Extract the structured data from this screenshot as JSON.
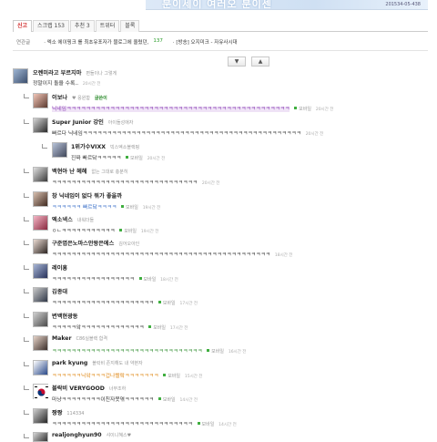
{
  "banner": {
    "text": "분이세이 여러오 분이센",
    "code": "201534-05-438"
  },
  "tabs": [
    {
      "label": "신고",
      "active": true
    },
    {
      "label": "스크랩 153",
      "active": false
    },
    {
      "label": "추천 3",
      "active": false
    },
    {
      "label": "트위터",
      "active": false
    },
    {
      "label": "블록",
      "active": false
    }
  ],
  "related": {
    "label": "연관글",
    "items": [
      {
        "text": "· 엑소 에이핑크 를 최초유포자가 블로그에 올렸던,",
        "count": "137"
      },
      {
        "text": "· [방송] 오지미크 - 자유사시대",
        "count": ""
      }
    ]
  },
  "pager": {
    "up": "▲",
    "down": "▼"
  },
  "comments": [
    {
      "nick": "오렌미라고 부르지마",
      "sub": "편들이나 그렇게",
      "text": "정말이지 돌을 수록..",
      "mobile": "",
      "time": "20시간 전"
    },
    {
      "nick": "이보나",
      "sub": "♥ 응원함",
      "text": "닉네임ㅋㅋㅋㅋㅋㅋㅋㅋㅋㅋㅋㅋㅋㅋㅋㅋㅋㅋㅋㅋㅋㅋㅋㅋㅋㅋㅋㅋㅋㅋㅋㅋㅋㅋㅋㅋㅋㅋㅋㅋㅋㅋㅋㅋㅋㅋ",
      "mobile": "모바일",
      "time": "20시간 전",
      "extra": "글쓴이"
    },
    {
      "nick": "Super Junior 강인",
      "sub": "아이돌성애자",
      "text": "빠르다 닉네임ㅋㅋㅋㅋㅋㅋㅋㅋㅋㅋㅋㅋㅋㅋㅋㅋㅋㅋㅋㅋㅋㅋㅋㅋㅋㅋㅋㅋㅋㅋㅋㅋㅋㅋㅋㅋㅋㅋㅋㅋㅋㅋㅋㅋㅋ",
      "mobile": "",
      "time": "20시간 전"
    },
    {
      "nick": "1위가수VIXX",
      "sub": "빅스엑소블랙핑",
      "text": "진짜 빠르닼ㅋㅋㅋㅋㅋ",
      "mobile": "모바일",
      "time": "20시간 전"
    },
    {
      "nick": "백현아 난 헤헤",
      "sub": "없는 그대로 충분히",
      "text": "ㅋㅋㅋㅋㅋㅋㅋㅋㅋㅋㅋㅋㅋㅋㅋㅋㅋㅋㅋㅋㅋㅋㅋㅋㅋㅋㅋㅋㅋㅋ",
      "mobile": "",
      "time": "20시간 전"
    },
    {
      "nick": "창 닉네임이 없다 뭐가 좋을까",
      "sub": "",
      "text": "ㅋㅋㅋㅋㅋㅋ 빠르닼ㅋㅋㅋㅋ",
      "mobile": "모바일",
      "time": "19시간 전"
    },
    {
      "nick": "엑소넥스",
      "sub": "내워더들",
      "text": "ㅇㄴㅋㅋㅋㅋㅋㅋㅋㅋㅋㅋㅋ",
      "mobile": "모바일",
      "time": "19시간 전"
    },
    {
      "nick": "구준엽은노마스안왕은에스",
      "sub": "김어오아인",
      "text": "ㅋㅋㅋㅋㅋㅋㅋㅋㅋㅋㅋㅋㅋㅋㅋㅋㅋㅋㅋㅋㅋㅋㅋㅋㅋㅋㅋㅋㅋㅋㅋㅋㅋㅋㅋㅋㅋㅋㅋㅋㅋㅋㅋㅋㅋ",
      "mobile": "",
      "time": "18시간 전"
    },
    {
      "nick": "레이흥",
      "sub": "",
      "text": "ㅋㅋㅋㅋㅋㅋㅋㅋㅋㅋㅋㅋㅋㅋㅋㅋㅋ",
      "mobile": "모바일",
      "time": "18시간 전"
    },
    {
      "nick": "김종대",
      "sub": "",
      "text": "ㅋㅋㅋㅋㅋㅋㅋㅋㅋㅋㅋㅋㅋㅋㅋㅋㅋㅋㅋㅋㅋ",
      "mobile": "모바일",
      "time": "17시간 전"
    },
    {
      "nick": "변백현광동",
      "sub": "",
      "text": "ㅋㅋㅋㅋㅋ앜ㅋㅋㅋㅋㅋㅋㅋㅋㅋㅋㅋㅋㅋ",
      "mobile": "모바일",
      "time": "17시간 전"
    },
    {
      "nick": "Maker",
      "sub": "C86실블랙 합격",
      "text": "ㅋㅋㅋㅋㅋㅋㅋㅋㅋㅋㅋㅋㅋㅋㅋㅋㅋㅋㅋㅋㅋㅋㅋㅋㅋㅋㅋㅋㅋㅋㅋ",
      "mobile": "모바일",
      "time": "16시간 전"
    },
    {
      "nick": "park kyung",
      "sub": "블락비 존지해도 내 약본자",
      "text": "ㅋㅋㅋㅋㅋㅋ닉앜ㅋㅋㅋ겁나빨랔ㅋㅋㅋㅋㅋㅋㅋ",
      "mobile": "모바일",
      "time": "15시간 전"
    },
    {
      "nick": "블락비 VERYGOOD",
      "sub": "너무조하",
      "text": "마냥ㅋㅋㅋㅋㅋㅋㅋㅋ이친자못엮ㅋㅋㅋㅋㅋㅋ",
      "mobile": "모바일",
      "time": "14시간 전"
    },
    {
      "nick": "짱짱",
      "sub": "114334",
      "text": "ㅋㅋㅋㅋㅋㅋㅋㅋㅋㅋㅋㅋㅋㅋㅋㅋㅋㅋㅋㅋㅋㅋㅋㅋㅋㅋㅋㅋㅋ",
      "mobile": "모바일",
      "time": "14시간 전"
    },
    {
      "nick": "realjonghyun90",
      "sub": "샤이니혜스♥",
      "text": "",
      "mobile": "",
      "time": ""
    }
  ],
  "colors": {
    "active_tab": "#d12a2a",
    "mobile_dot": "#3fae3f",
    "purple_highlight": "#8b3fb5",
    "green_text": "#2a8a2a"
  }
}
